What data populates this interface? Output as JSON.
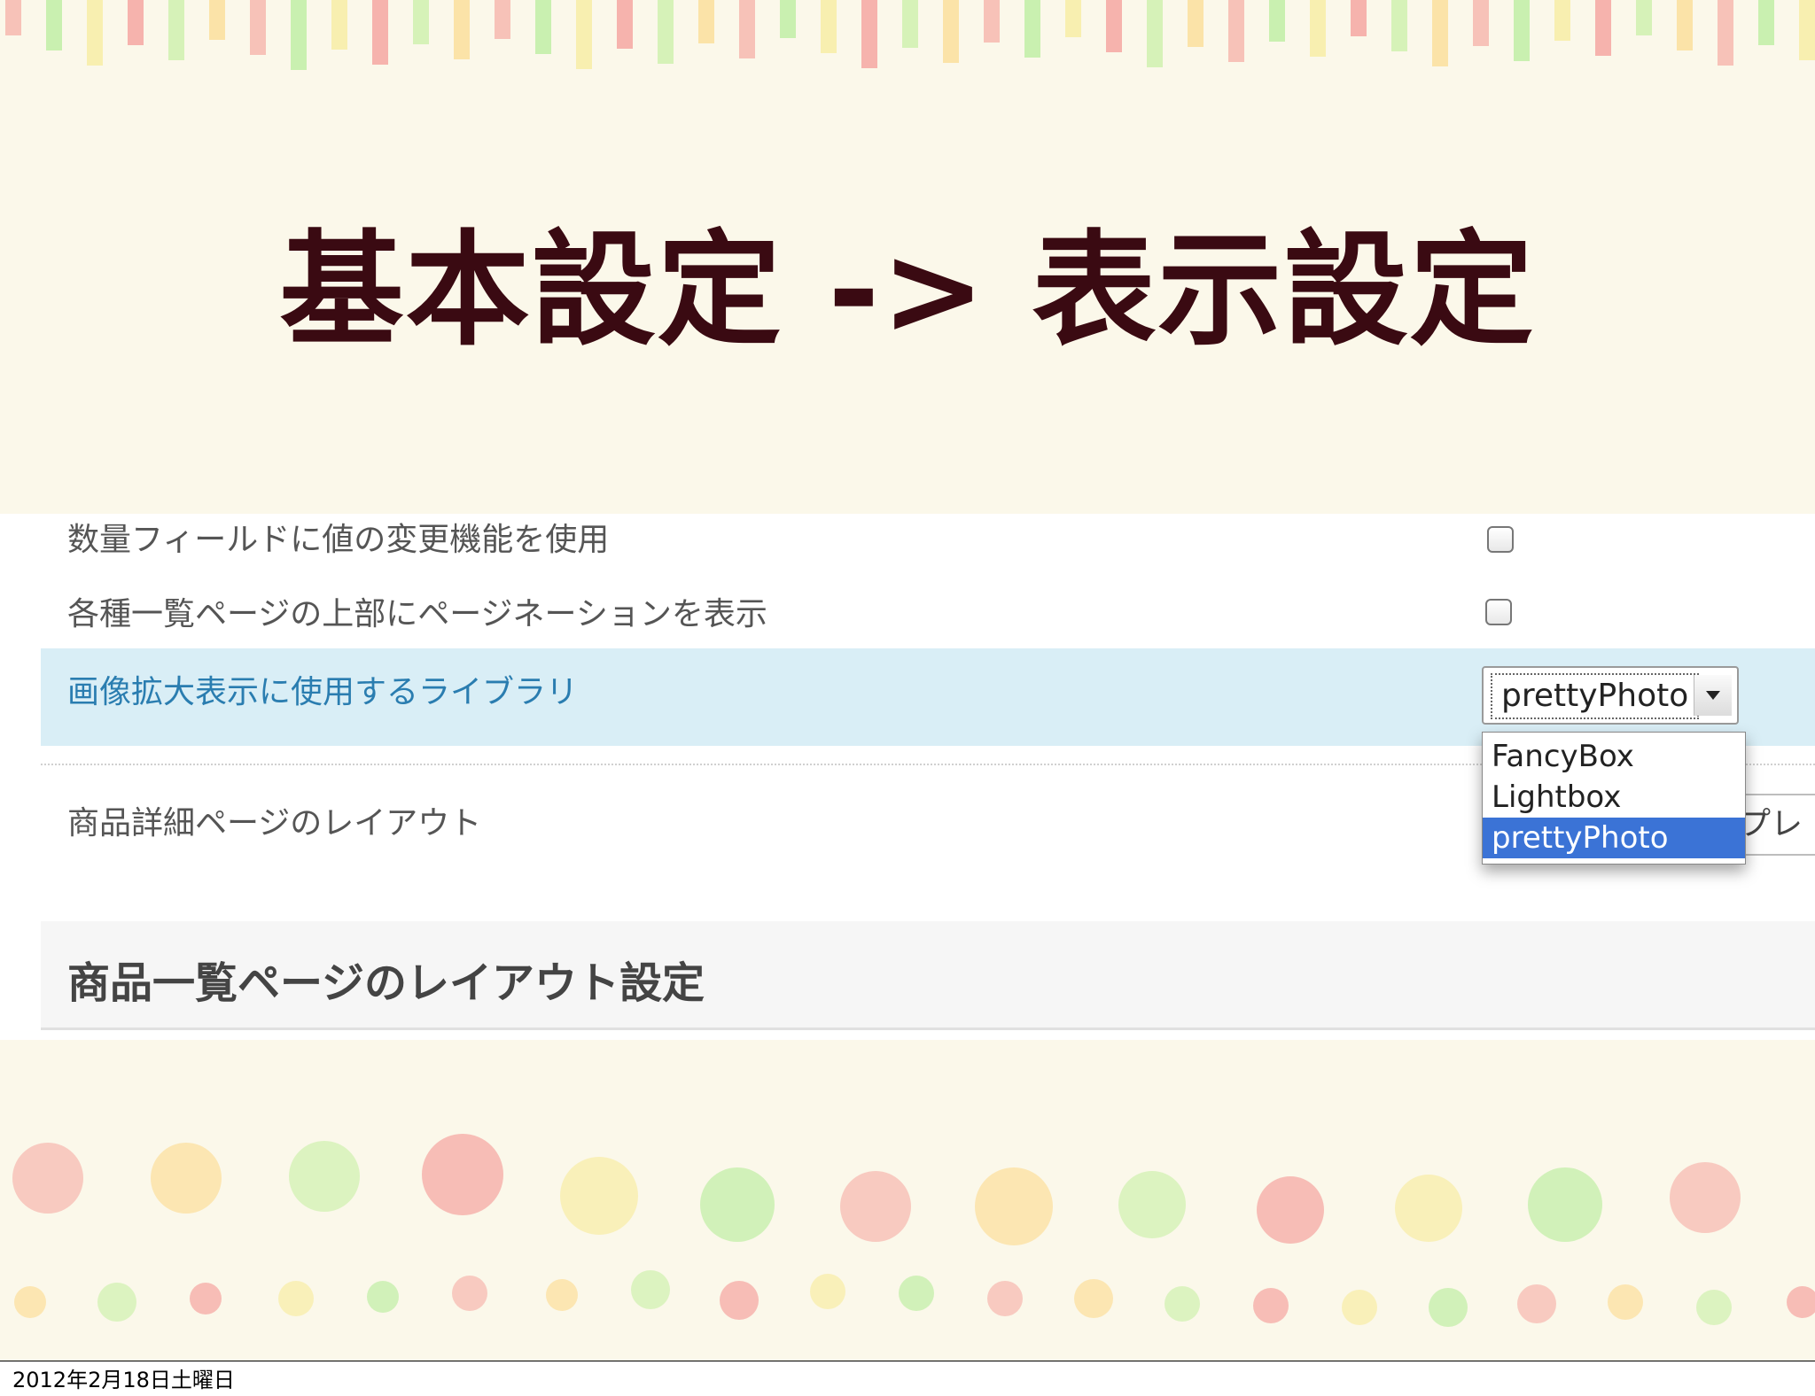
{
  "slide": {
    "title": "基本設定 -> 表示設定"
  },
  "settings": {
    "rows": [
      {
        "label": "数量フィールドに値の変更機能を使用",
        "checked": false
      },
      {
        "label": "各種一覧ページの上部にページネーションを表示",
        "checked": false
      }
    ],
    "library": {
      "label": "画像拡大表示に使用するライブラリ",
      "selected": "prettyPhoto",
      "options": [
        "FancyBox",
        "Lightbox",
        "prettyPhoto"
      ]
    },
    "layout": {
      "label": "商品詳細ページのレイアウト",
      "partial_value": "プレ"
    },
    "section_title": "商品一覧ページのレイアウト設定"
  },
  "footer": {
    "date": "2012年2月18日土曜日"
  },
  "colors": {
    "title": "#3a0a12",
    "highlight_row": "#d9eef6",
    "highlight_text": "#2a7db0",
    "dropdown_selected": "#3b73d6",
    "slide_bg": "#fbf8ea"
  }
}
